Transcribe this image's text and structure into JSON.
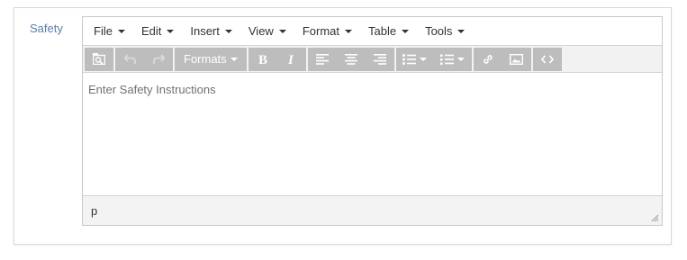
{
  "field": {
    "label": "Safety"
  },
  "menubar": {
    "items": [
      {
        "label": "File"
      },
      {
        "label": "Edit"
      },
      {
        "label": "Insert"
      },
      {
        "label": "View"
      },
      {
        "label": "Format"
      },
      {
        "label": "Table"
      },
      {
        "label": "Tools"
      }
    ]
  },
  "toolbar": {
    "formats_label": "Formats",
    "icons": [
      "image-search-icon",
      "undo-icon",
      "redo-icon",
      "bold-icon",
      "italic-icon",
      "align-left-icon",
      "align-center-icon",
      "align-right-icon",
      "bullet-list-icon",
      "numbered-list-icon",
      "link-icon",
      "image-icon",
      "code-icon"
    ]
  },
  "editor": {
    "placeholder": "Enter Safety Instructions"
  },
  "statusbar": {
    "path": "p"
  },
  "colors": {
    "label": "#5b7fa8",
    "toolbar_button_bg": "#bdbdbd",
    "toolbar_bg": "#f2f2f2"
  }
}
